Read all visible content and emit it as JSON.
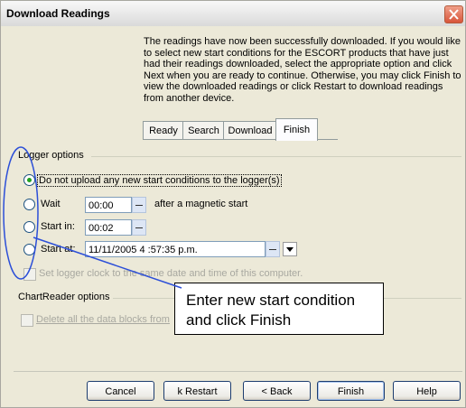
{
  "window": {
    "title": "Download Readings"
  },
  "intro_text": "The readings have now been successfully downloaded. If you would like to select new start conditions for the ESCORT products that have just had their readings downloaded, select the appropriate option and click Next when you are ready to continue. Otherwise, you may click Finish to view the downloaded readings or click Restart to download readings from another device.",
  "tabs": [
    {
      "label": "Ready",
      "active": false
    },
    {
      "label": "Search",
      "active": false
    },
    {
      "label": "Download",
      "active": false
    },
    {
      "label": "Finish",
      "active": true
    }
  ],
  "logger_options": {
    "header": "Logger options",
    "no_upload": {
      "label": "Do not upload any new start conditions to the logger(s)",
      "checked": true
    },
    "wait": {
      "label": "Wait",
      "value": "00:00",
      "suffix": "after a magnetic start"
    },
    "start_in": {
      "label": "Start in:",
      "value": "00:02"
    },
    "start_at": {
      "label": "Start at:",
      "value": "11/11/2005  4 :57:35 p.m."
    },
    "set_clock": {
      "label": "Set logger clock to the same date and time of this computer."
    }
  },
  "chartreader": {
    "header": "ChartReader options",
    "delete_blocks": {
      "label": "Delete all the data blocks from"
    }
  },
  "buttons": {
    "cancel": "Cancel",
    "restart": "k Restart",
    "back": "< Back",
    "finish": "Finish",
    "help": "Help"
  },
  "callout": {
    "line1": "Enter new start condition",
    "line2": "and click Finish"
  },
  "colors": {
    "annotation_blue": "#2c4fd8",
    "radio_dot": "#21a121"
  }
}
